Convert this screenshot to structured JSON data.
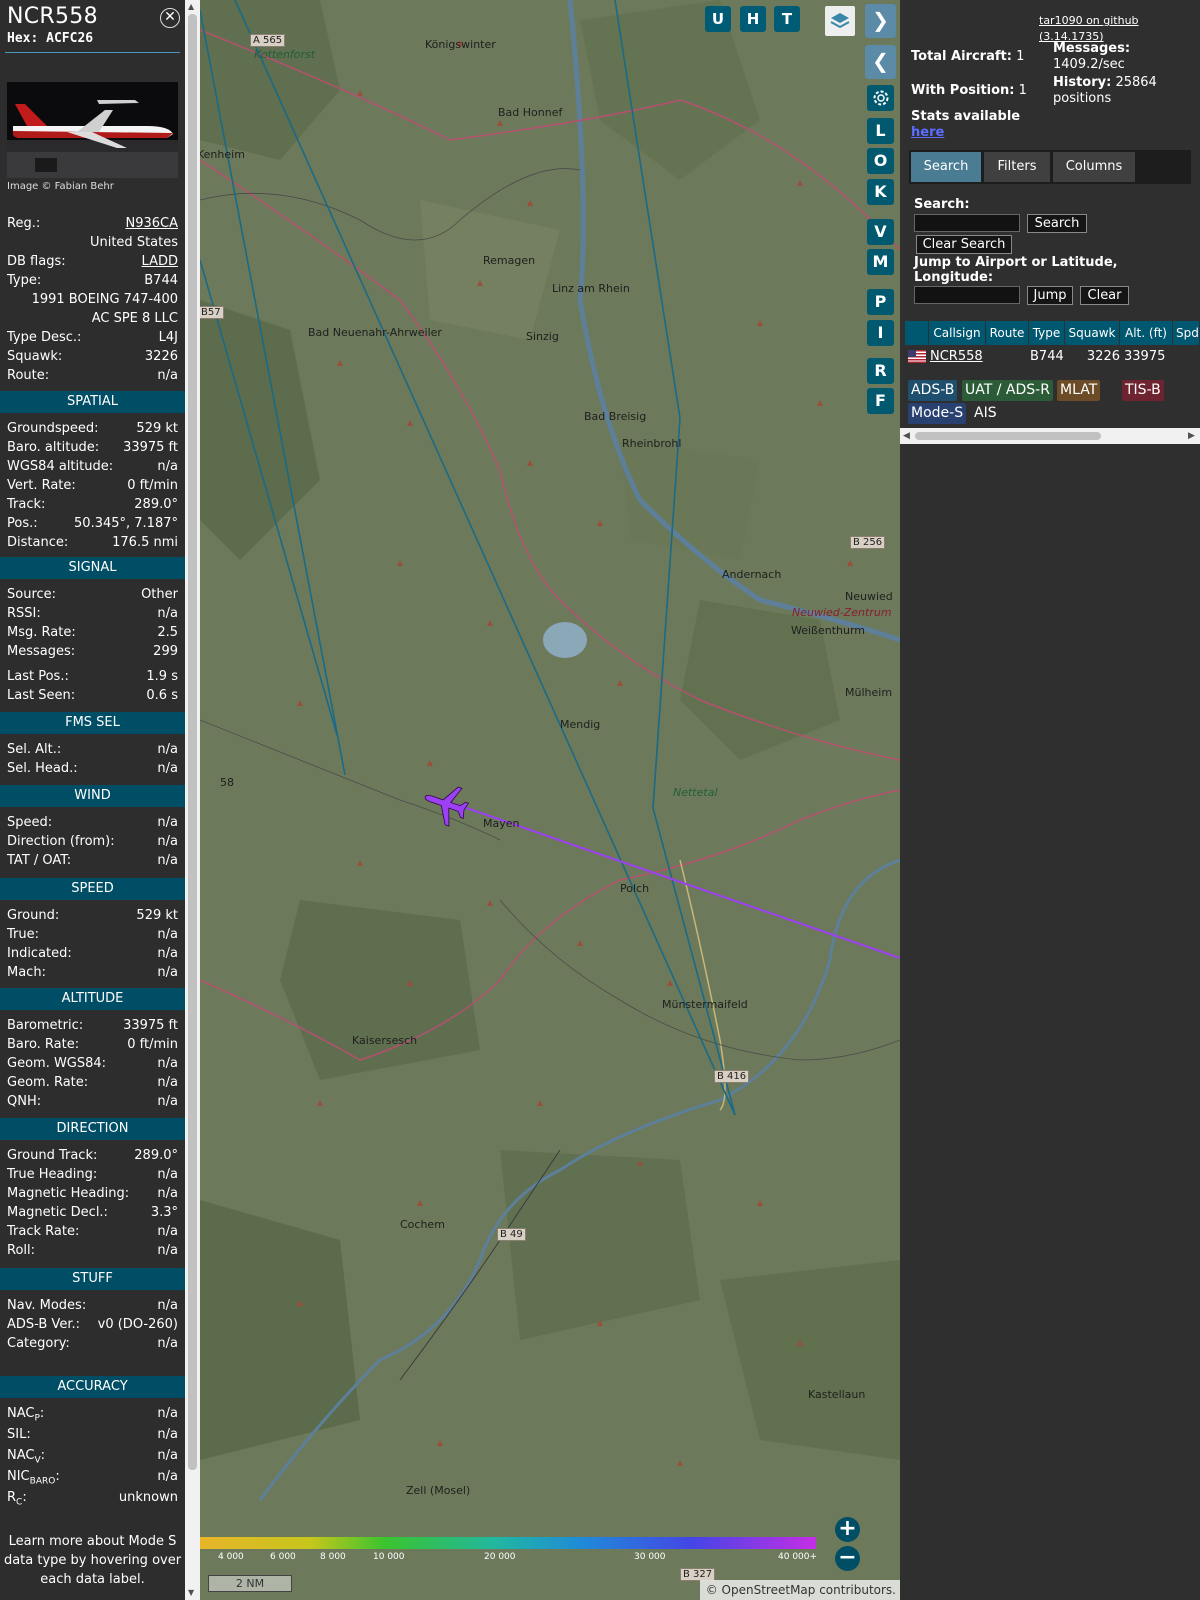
{
  "aircraft": {
    "callsign": "NCR558",
    "hex_label": "Hex:",
    "hex": "ACFC26",
    "photo_credit": "Image © Fabian Behr"
  },
  "info_rows": [
    {
      "label": "Reg.:",
      "value": "N936CA",
      "link": true
    },
    {
      "label": "",
      "value": "United States"
    },
    {
      "label": "DB flags:",
      "value": "LADD",
      "link": true
    },
    {
      "label": "Type:",
      "value": "B744"
    },
    {
      "label": "",
      "value": "1991 BOEING 747-400"
    },
    {
      "label": "",
      "value": "AC SPE 8 LLC"
    },
    {
      "label": "Type Desc.:",
      "value": "L4J"
    },
    {
      "label": "Squawk:",
      "value": "3226"
    },
    {
      "label": "Route:",
      "value": "n/a"
    }
  ],
  "sections": [
    {
      "title": "SPATIAL",
      "rows": [
        {
          "label": "Groundspeed:",
          "value": "529 kt"
        },
        {
          "label": "Baro. altitude:",
          "value": "33975 ft"
        },
        {
          "label": "WGS84 altitude:",
          "value": "n/a"
        },
        {
          "label": "Vert. Rate:",
          "value": "0 ft/min"
        },
        {
          "label": "Track:",
          "value": "289.0°"
        },
        {
          "label": "Pos.:",
          "value": "50.345°, 7.187°"
        },
        {
          "label": "Distance:",
          "value": "176.5 nmi"
        }
      ]
    },
    {
      "title": "SIGNAL",
      "rows": [
        {
          "label": "Source:",
          "value": "Other"
        },
        {
          "label": "RSSI:",
          "value": "n/a"
        },
        {
          "label": "Msg. Rate:",
          "value": "2.5"
        },
        {
          "label": "Messages:",
          "value": "299"
        },
        {
          "label": "Last Pos.:",
          "value": "1.9 s"
        },
        {
          "label": "Last Seen:",
          "value": "0.6 s"
        }
      ]
    },
    {
      "title": "FMS SEL",
      "rows": [
        {
          "label": "Sel. Alt.:",
          "value": "n/a"
        },
        {
          "label": "Sel. Head.:",
          "value": "n/a"
        }
      ]
    },
    {
      "title": "WIND",
      "rows": [
        {
          "label": "Speed:",
          "value": "n/a"
        },
        {
          "label": "Direction (from):",
          "value": "n/a"
        },
        {
          "label": "TAT / OAT:",
          "value": "n/a"
        }
      ]
    },
    {
      "title": "SPEED",
      "rows": [
        {
          "label": "Ground:",
          "value": "529 kt"
        },
        {
          "label": "True:",
          "value": "n/a"
        },
        {
          "label": "Indicated:",
          "value": "n/a"
        },
        {
          "label": "Mach:",
          "value": "n/a"
        }
      ]
    },
    {
      "title": "ALTITUDE",
      "rows": [
        {
          "label": "Barometric:",
          "value": "33975 ft"
        },
        {
          "label": "Baro. Rate:",
          "value": "0 ft/min"
        },
        {
          "label": "Geom. WGS84:",
          "value": "n/a"
        },
        {
          "label": "Geom. Rate:",
          "value": "n/a"
        },
        {
          "label": "QNH:",
          "value": "n/a"
        }
      ]
    },
    {
      "title": "DIRECTION",
      "rows": [
        {
          "label": "Ground Track:",
          "value": "289.0°"
        },
        {
          "label": "True Heading:",
          "value": "n/a"
        },
        {
          "label": "Magnetic Heading:",
          "value": "n/a"
        },
        {
          "label": "Magnetic Decl.:",
          "value": "3.3°"
        },
        {
          "label": "Track Rate:",
          "value": "n/a"
        },
        {
          "label": "Roll:",
          "value": "n/a"
        }
      ]
    },
    {
      "title": "STUFF",
      "rows": [
        {
          "label": "Nav. Modes:",
          "value": "n/a"
        },
        {
          "label": "ADS-B Ver.:",
          "value": "v0 (DO-260)"
        },
        {
          "label": "Category:",
          "value": "n/a"
        }
      ]
    },
    {
      "title": "ACCURACY",
      "rows": [
        {
          "label": "NAC",
          "sub": "P",
          "label_after": ":",
          "value": "n/a"
        },
        {
          "label": "SIL:",
          "value": "n/a"
        },
        {
          "label": "NAC",
          "sub": "V",
          "label_after": ":",
          "value": "n/a"
        },
        {
          "label": "NIC",
          "sub": "BARO",
          "label_after": ":",
          "value": "n/a"
        },
        {
          "label": "R",
          "sub": "C",
          "label_after": ":",
          "value": "unknown"
        }
      ]
    }
  ],
  "learn_more": "Learn more about Mode S data type by hovering over each data label.",
  "map": {
    "top_buttons": [
      "U",
      "H",
      "T"
    ],
    "side_buttons": [
      "L",
      "O",
      "K",
      "V",
      "M",
      "P",
      "I",
      "R",
      "F"
    ],
    "place_labels": [
      "Königswinter",
      "Bad Honnef",
      "Remagen",
      "Linz am Rhein",
      "Sinzig",
      "Bad Neuenahr-Ahrweiler",
      "Bad Breisig",
      "Rheinbrohl",
      "Andernach",
      "Neuwied",
      "Neuwied-Zentrum",
      "Weißenthurm",
      "Mülheim",
      "Mendig",
      "Mayen",
      "Polch",
      "Nettetal",
      "Münstermaifeld",
      "Kaisersesch",
      "Cochem",
      "Kastellaun",
      "Zell (Mosel)",
      "Kottenforst",
      "Kenheim",
      "A 565",
      "B 256",
      "B 416",
      "B 49",
      "B 327",
      "B57",
      "58"
    ],
    "legend_ticks": [
      "4 000",
      "6 000",
      "8 000",
      "10 000",
      "20 000",
      "30 000",
      "40 000+"
    ],
    "scale": "2 NM",
    "attribution": "© OpenStreetMap contributors."
  },
  "panel": {
    "github_link": "tar1090 on github (3.14.1735)",
    "total_label": "Total Aircraft:",
    "total_value": "1",
    "position_label": "With Position:",
    "position_value": "1",
    "messages_label": "Messages:",
    "messages_value": "1409.2/sec",
    "history_label": "History:",
    "history_value": "25864 positions",
    "stats_label": "Stats available",
    "stats_link": "here",
    "tabs": [
      "Search",
      "Filters",
      "Columns"
    ],
    "search_label": "Search:",
    "search_button": "Search",
    "clear_search_button": "Clear Search",
    "jump_label": "Jump to Airport or Latitude, Longitude:",
    "jump_button": "Jump",
    "clear_button": "Clear",
    "columns": [
      "Callsign",
      "Route",
      "Type",
      "Squawk",
      "Alt. (ft)",
      "Spd."
    ],
    "table_row": {
      "callsign": "NCR558",
      "type": "B744",
      "squawk": "3226",
      "altitude": "33975"
    },
    "source_badges": [
      {
        "label": "ADS-B",
        "color": "#1f4f6e"
      },
      {
        "label": "UAT / ADS-R",
        "color": "#2b5c37"
      },
      {
        "label": "MLAT",
        "color": "#6b4c26"
      },
      {
        "label": "TIS-B",
        "color": "#6e2331"
      },
      {
        "label": "Mode-S",
        "color": "#284170"
      },
      {
        "label": "AIS",
        "color": "#2f2f2f"
      }
    ]
  },
  "colors": {
    "section_bg": "#004e66",
    "button_bg": "#005b75",
    "aircraft_icon": "#9d3ff2",
    "track_line": "#9d3ff2",
    "trail_lines": "#1b6a86"
  }
}
